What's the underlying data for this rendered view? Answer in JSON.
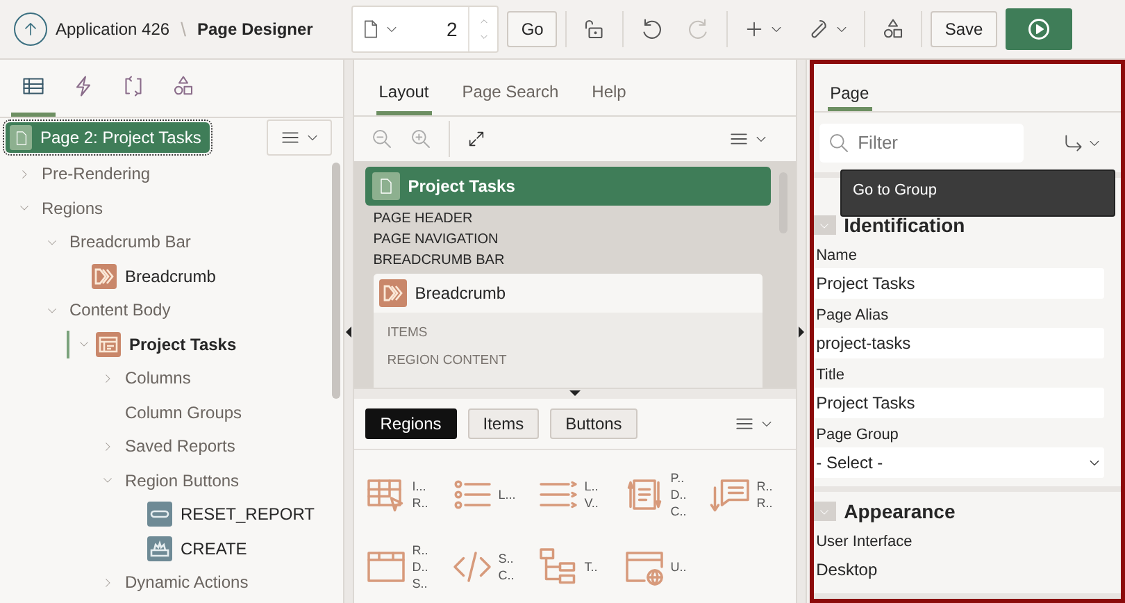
{
  "header": {
    "app": "Application 426",
    "separator": "\\",
    "title": "Page Designer",
    "page_number": "2",
    "go": "Go",
    "tools": [
      {
        "kind": "lock",
        "disabled": false
      },
      {
        "kind": "undo",
        "disabled": false
      },
      {
        "kind": "redo",
        "disabled": true
      },
      {
        "kind": "add-menu",
        "disabled": false
      },
      {
        "kind": "utilities-menu",
        "disabled": false
      },
      {
        "kind": "shared",
        "disabled": false
      }
    ],
    "save": "Save"
  },
  "left": {
    "tabs": [
      {
        "kind": "rendering",
        "selected": true
      },
      {
        "kind": "dynamic-actions",
        "selected": false
      },
      {
        "kind": "processing",
        "selected": false
      },
      {
        "kind": "shared",
        "selected": false
      }
    ],
    "root": {
      "label": "Page 2: Project Tasks",
      "selected": true
    },
    "tree": [
      {
        "label": "Pre-Rendering",
        "kind": "group",
        "expanded": false,
        "current": false
      },
      {
        "label": "Regions",
        "kind": "group",
        "expanded": true,
        "current": false,
        "children": [
          {
            "label": "Breadcrumb Bar",
            "kind": "group",
            "expanded": true,
            "current": false,
            "children": [
              {
                "label": "Breadcrumb",
                "kind": "breadcrumb",
                "current": false
              }
            ]
          },
          {
            "label": "Content Body",
            "kind": "group",
            "expanded": true,
            "current": false,
            "children": [
              {
                "label": "Project Tasks",
                "kind": "report",
                "expanded": true,
                "current": true,
                "children": [
                  {
                    "label": "Columns",
                    "kind": "group",
                    "expanded": false,
                    "current": false
                  },
                  {
                    "label": "Column Groups",
                    "kind": "plain",
                    "current": false
                  },
                  {
                    "label": "Saved Reports",
                    "kind": "group",
                    "expanded": false,
                    "current": false
                  },
                  {
                    "label": "Region Buttons",
                    "kind": "group",
                    "expanded": true,
                    "current": false,
                    "children": [
                      {
                        "label": "RESET_REPORT",
                        "kind": "button",
                        "current": false
                      },
                      {
                        "label": "CREATE",
                        "kind": "create-button",
                        "current": false
                      }
                    ]
                  },
                  {
                    "label": "Dynamic Actions",
                    "kind": "group",
                    "expanded": false,
                    "current": false
                  }
                ]
              }
            ]
          }
        ]
      }
    ]
  },
  "middle": {
    "tabs": [
      {
        "label": "Layout",
        "selected": true
      },
      {
        "label": "Page Search",
        "selected": false
      },
      {
        "label": "Help",
        "selected": false
      }
    ],
    "canvas": {
      "page_title": "Project Tasks",
      "positions": [
        "PAGE HEADER",
        "PAGE NAVIGATION",
        "BREADCRUMB BAR"
      ],
      "region": {
        "title": "Breadcrumb",
        "slots": [
          "ITEMS",
          "REGION CONTENT"
        ]
      }
    },
    "gallery": {
      "tabs": [
        {
          "label": "Regions",
          "selected": true
        },
        {
          "label": "Items",
          "selected": false
        },
        {
          "label": "Buttons",
          "selected": false
        }
      ],
      "items": [
        {
          "kind": "interactive-grid",
          "lines": [
            "I...",
            "R.."
          ]
        },
        {
          "kind": "list",
          "lines": [
            "L..."
          ]
        },
        {
          "kind": "list-view",
          "lines": [
            "L..",
            "V.."
          ]
        },
        {
          "kind": "page-data",
          "lines": [
            "P..",
            "D..",
            "C.."
          ]
        },
        {
          "kind": "reflow",
          "lines": [
            "R..",
            "R.."
          ]
        },
        {
          "kind": "region-display",
          "lines": [
            "R..",
            "D..",
            "S.."
          ]
        },
        {
          "kind": "static",
          "lines": [
            "S..",
            "C.."
          ]
        },
        {
          "kind": "tree",
          "lines": [
            "T.."
          ]
        },
        {
          "kind": "url",
          "lines": [
            "U.."
          ]
        }
      ]
    }
  },
  "right": {
    "tab": {
      "label": "Page",
      "selected": true
    },
    "filter": {
      "placeholder": "Filter"
    },
    "tooltip": "Go to Group",
    "sections": [
      {
        "title": "Identification",
        "expanded": true,
        "fields": [
          {
            "label": "Name",
            "kind": "text",
            "value": "Project Tasks"
          },
          {
            "label": "Page Alias",
            "kind": "text",
            "value": "project-tasks"
          },
          {
            "label": "Title",
            "kind": "text",
            "value": "Project Tasks"
          },
          {
            "label": "Page Group",
            "kind": "select",
            "value": "- Select -"
          }
        ]
      },
      {
        "title": "Appearance",
        "expanded": true,
        "fields": [
          {
            "label": "User Interface",
            "kind": "static",
            "value": "Desktop"
          }
        ]
      }
    ]
  }
}
